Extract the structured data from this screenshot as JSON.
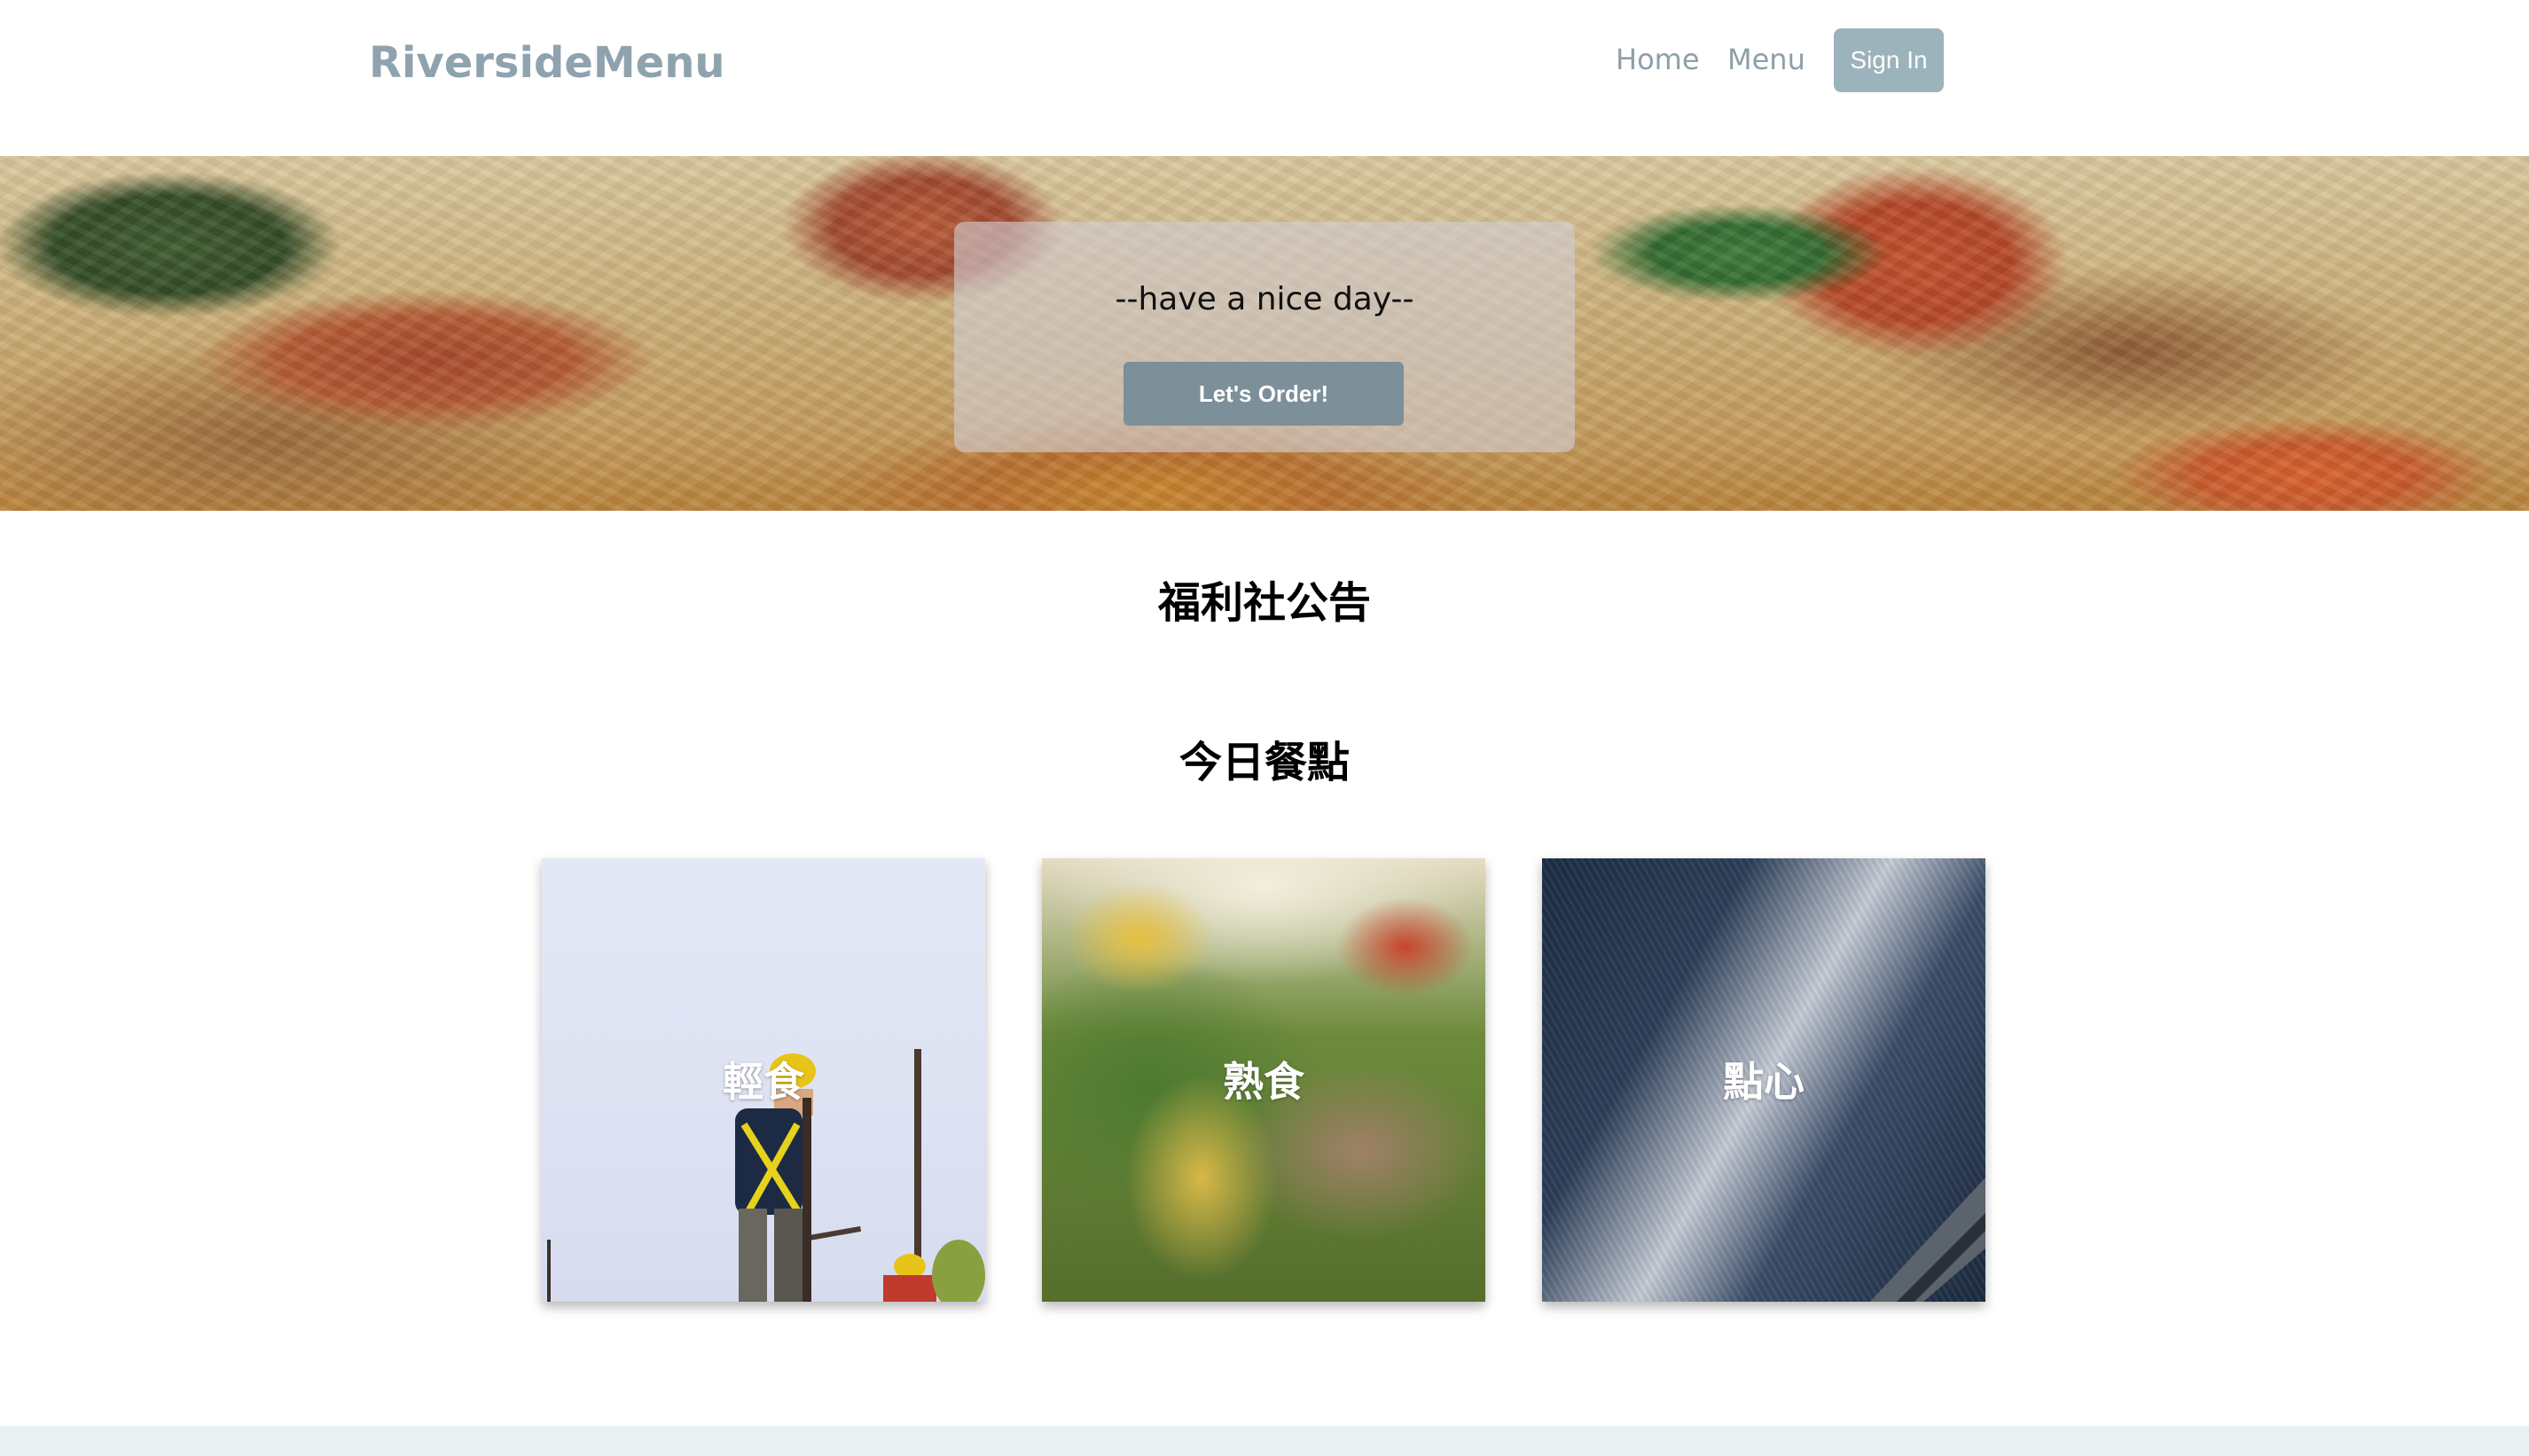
{
  "navbar": {
    "brand": "RiversideMenu",
    "links": [
      {
        "label": "Home"
      },
      {
        "label": "Menu"
      }
    ],
    "signin_label": "Sign In"
  },
  "hero": {
    "tagline": "--have a nice day--",
    "cta_label": "Let's Order!"
  },
  "sections": {
    "announcement_title": "福利社公告",
    "today_title": "今日餐點"
  },
  "cards": [
    {
      "label": "輕食"
    },
    {
      "label": "熟食"
    },
    {
      "label": "點心"
    }
  ],
  "colors": {
    "brand": "#8fa3ae",
    "signin_button": "#9cb3bb",
    "order_button": "#7d8f99",
    "footer": "#e8f0f1"
  }
}
